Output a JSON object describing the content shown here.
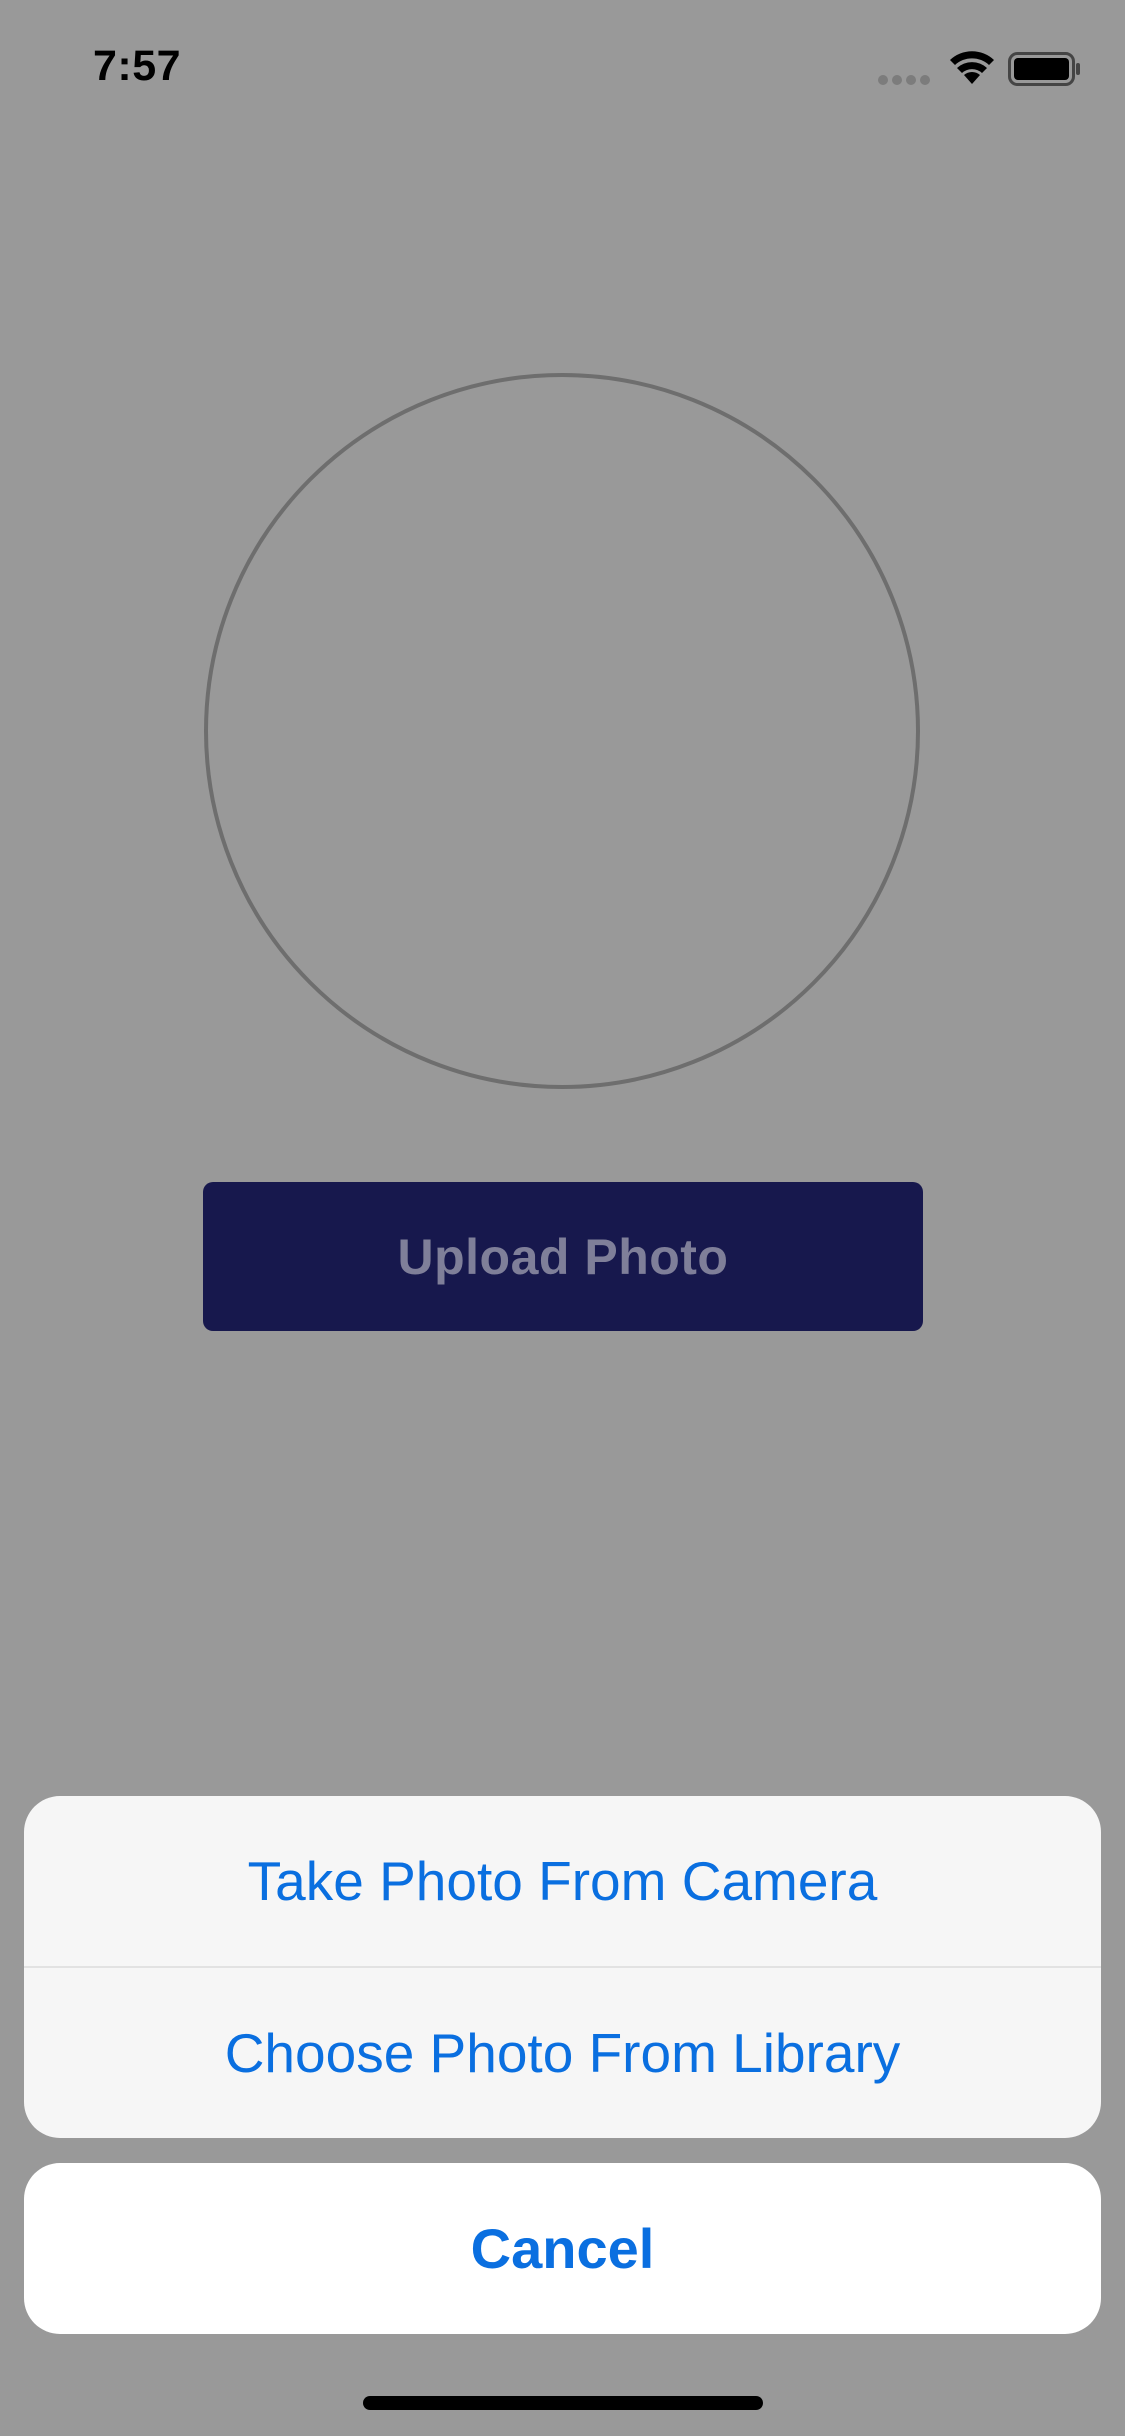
{
  "status_bar": {
    "time": "7:57",
    "icons": [
      "signal-dots-icon",
      "wifi-icon",
      "battery-icon"
    ]
  },
  "profile": {
    "avatar": "empty-avatar-placeholder",
    "upload_label": "Upload Photo"
  },
  "action_sheet": {
    "options": [
      {
        "label": "Take Photo From Camera"
      },
      {
        "label": "Choose Photo From Library"
      }
    ],
    "cancel_label": "Cancel"
  },
  "colors": {
    "background_dim": "#999999",
    "upload_button": "#17184d",
    "action_text": "#0a6fe0",
    "sheet_background": "#f6f6f6"
  }
}
